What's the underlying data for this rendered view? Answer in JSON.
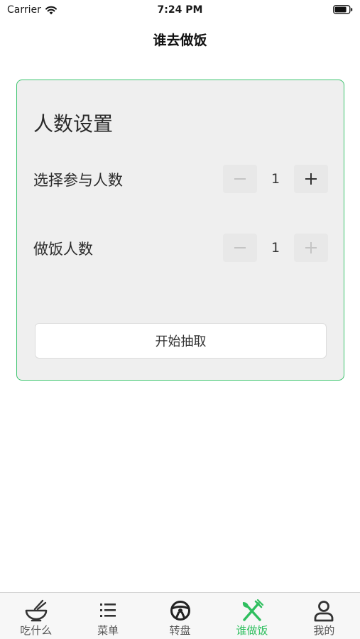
{
  "status_bar": {
    "carrier": "Carrier",
    "time": "7:24 PM"
  },
  "nav": {
    "title": "谁去做饭"
  },
  "card": {
    "title": "人数设置",
    "participants": {
      "label": "选择参与人数",
      "value": "1",
      "minus": "−",
      "plus": "+"
    },
    "cooks": {
      "label": "做饭人数",
      "value": "1",
      "minus": "−",
      "plus": "+"
    },
    "start_label": "开始抽取",
    "border_color": "#3cc46e"
  },
  "tab_bar": {
    "active_color": "#2fbf5f",
    "items": [
      {
        "label": "吃什么",
        "icon": "bowl-icon"
      },
      {
        "label": "菜单",
        "icon": "list-icon"
      },
      {
        "label": "转盘",
        "icon": "wheel-icon"
      },
      {
        "label": "谁做饭",
        "icon": "utensils-icon",
        "active": true
      },
      {
        "label": "我的",
        "icon": "person-icon"
      }
    ]
  }
}
